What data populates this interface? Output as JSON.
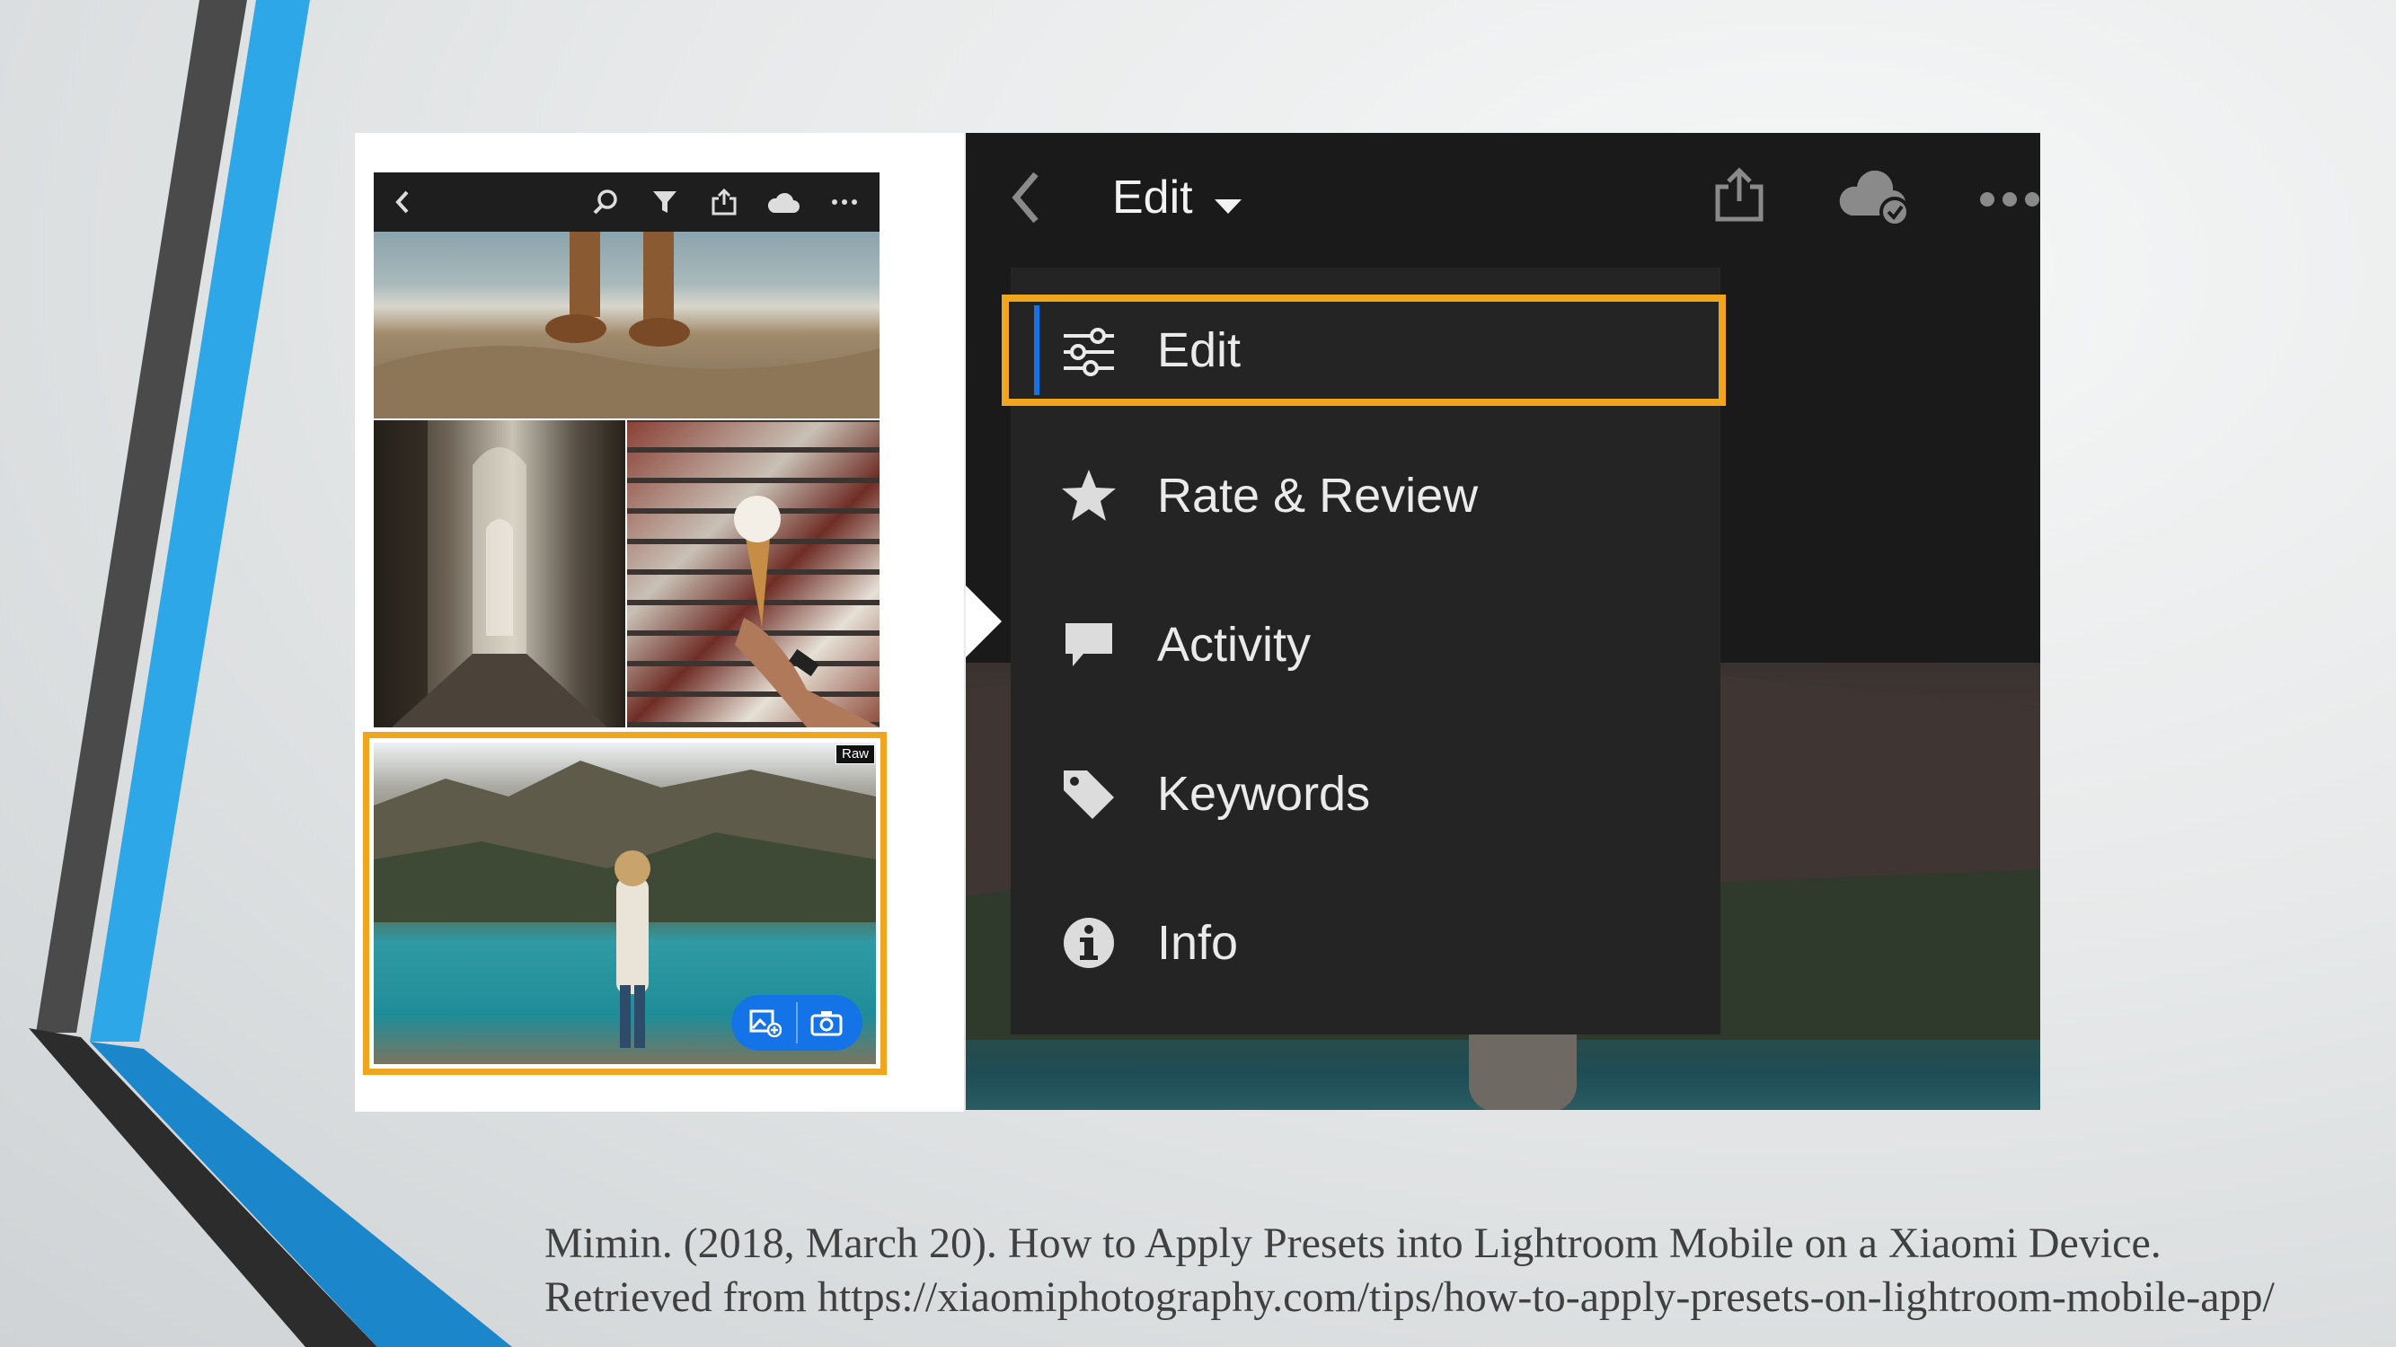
{
  "phone": {
    "toolbar_icons": [
      "chevron-left-icon",
      "search-icon",
      "filter-icon",
      "share-icon",
      "cloud-icon",
      "more-icon"
    ],
    "raw_badge": "Raw",
    "fab_icons": [
      "add-photo-icon",
      "camera-icon"
    ]
  },
  "detail": {
    "header_title": "Edit",
    "header_icons": [
      "chevron-left-icon",
      "share-icon",
      "cloud-synced-icon",
      "more-icon"
    ],
    "menu": [
      {
        "label": "Edit",
        "icon": "sliders-icon",
        "selected": true
      },
      {
        "label": "Rate & Review",
        "icon": "star-icon",
        "selected": false
      },
      {
        "label": "Activity",
        "icon": "comment-icon",
        "selected": false
      },
      {
        "label": "Keywords",
        "icon": "tag-icon",
        "selected": false
      },
      {
        "label": "Info",
        "icon": "info-icon",
        "selected": false
      }
    ]
  },
  "colors": {
    "highlight": "#f0a51f",
    "accent": "#1473e6",
    "deco_blue": "#2ea7e8",
    "deco_gray": "#4a4a4a"
  },
  "citation": {
    "line1": "Mimin. (2018, March 20). How to Apply Presets into Lightroom Mobile on a Xiaomi Device.",
    "line2": "Retrieved from https://xiaomiphotography.com/tips/how-to-apply-presets-on-lightroom-mobile-app/"
  }
}
